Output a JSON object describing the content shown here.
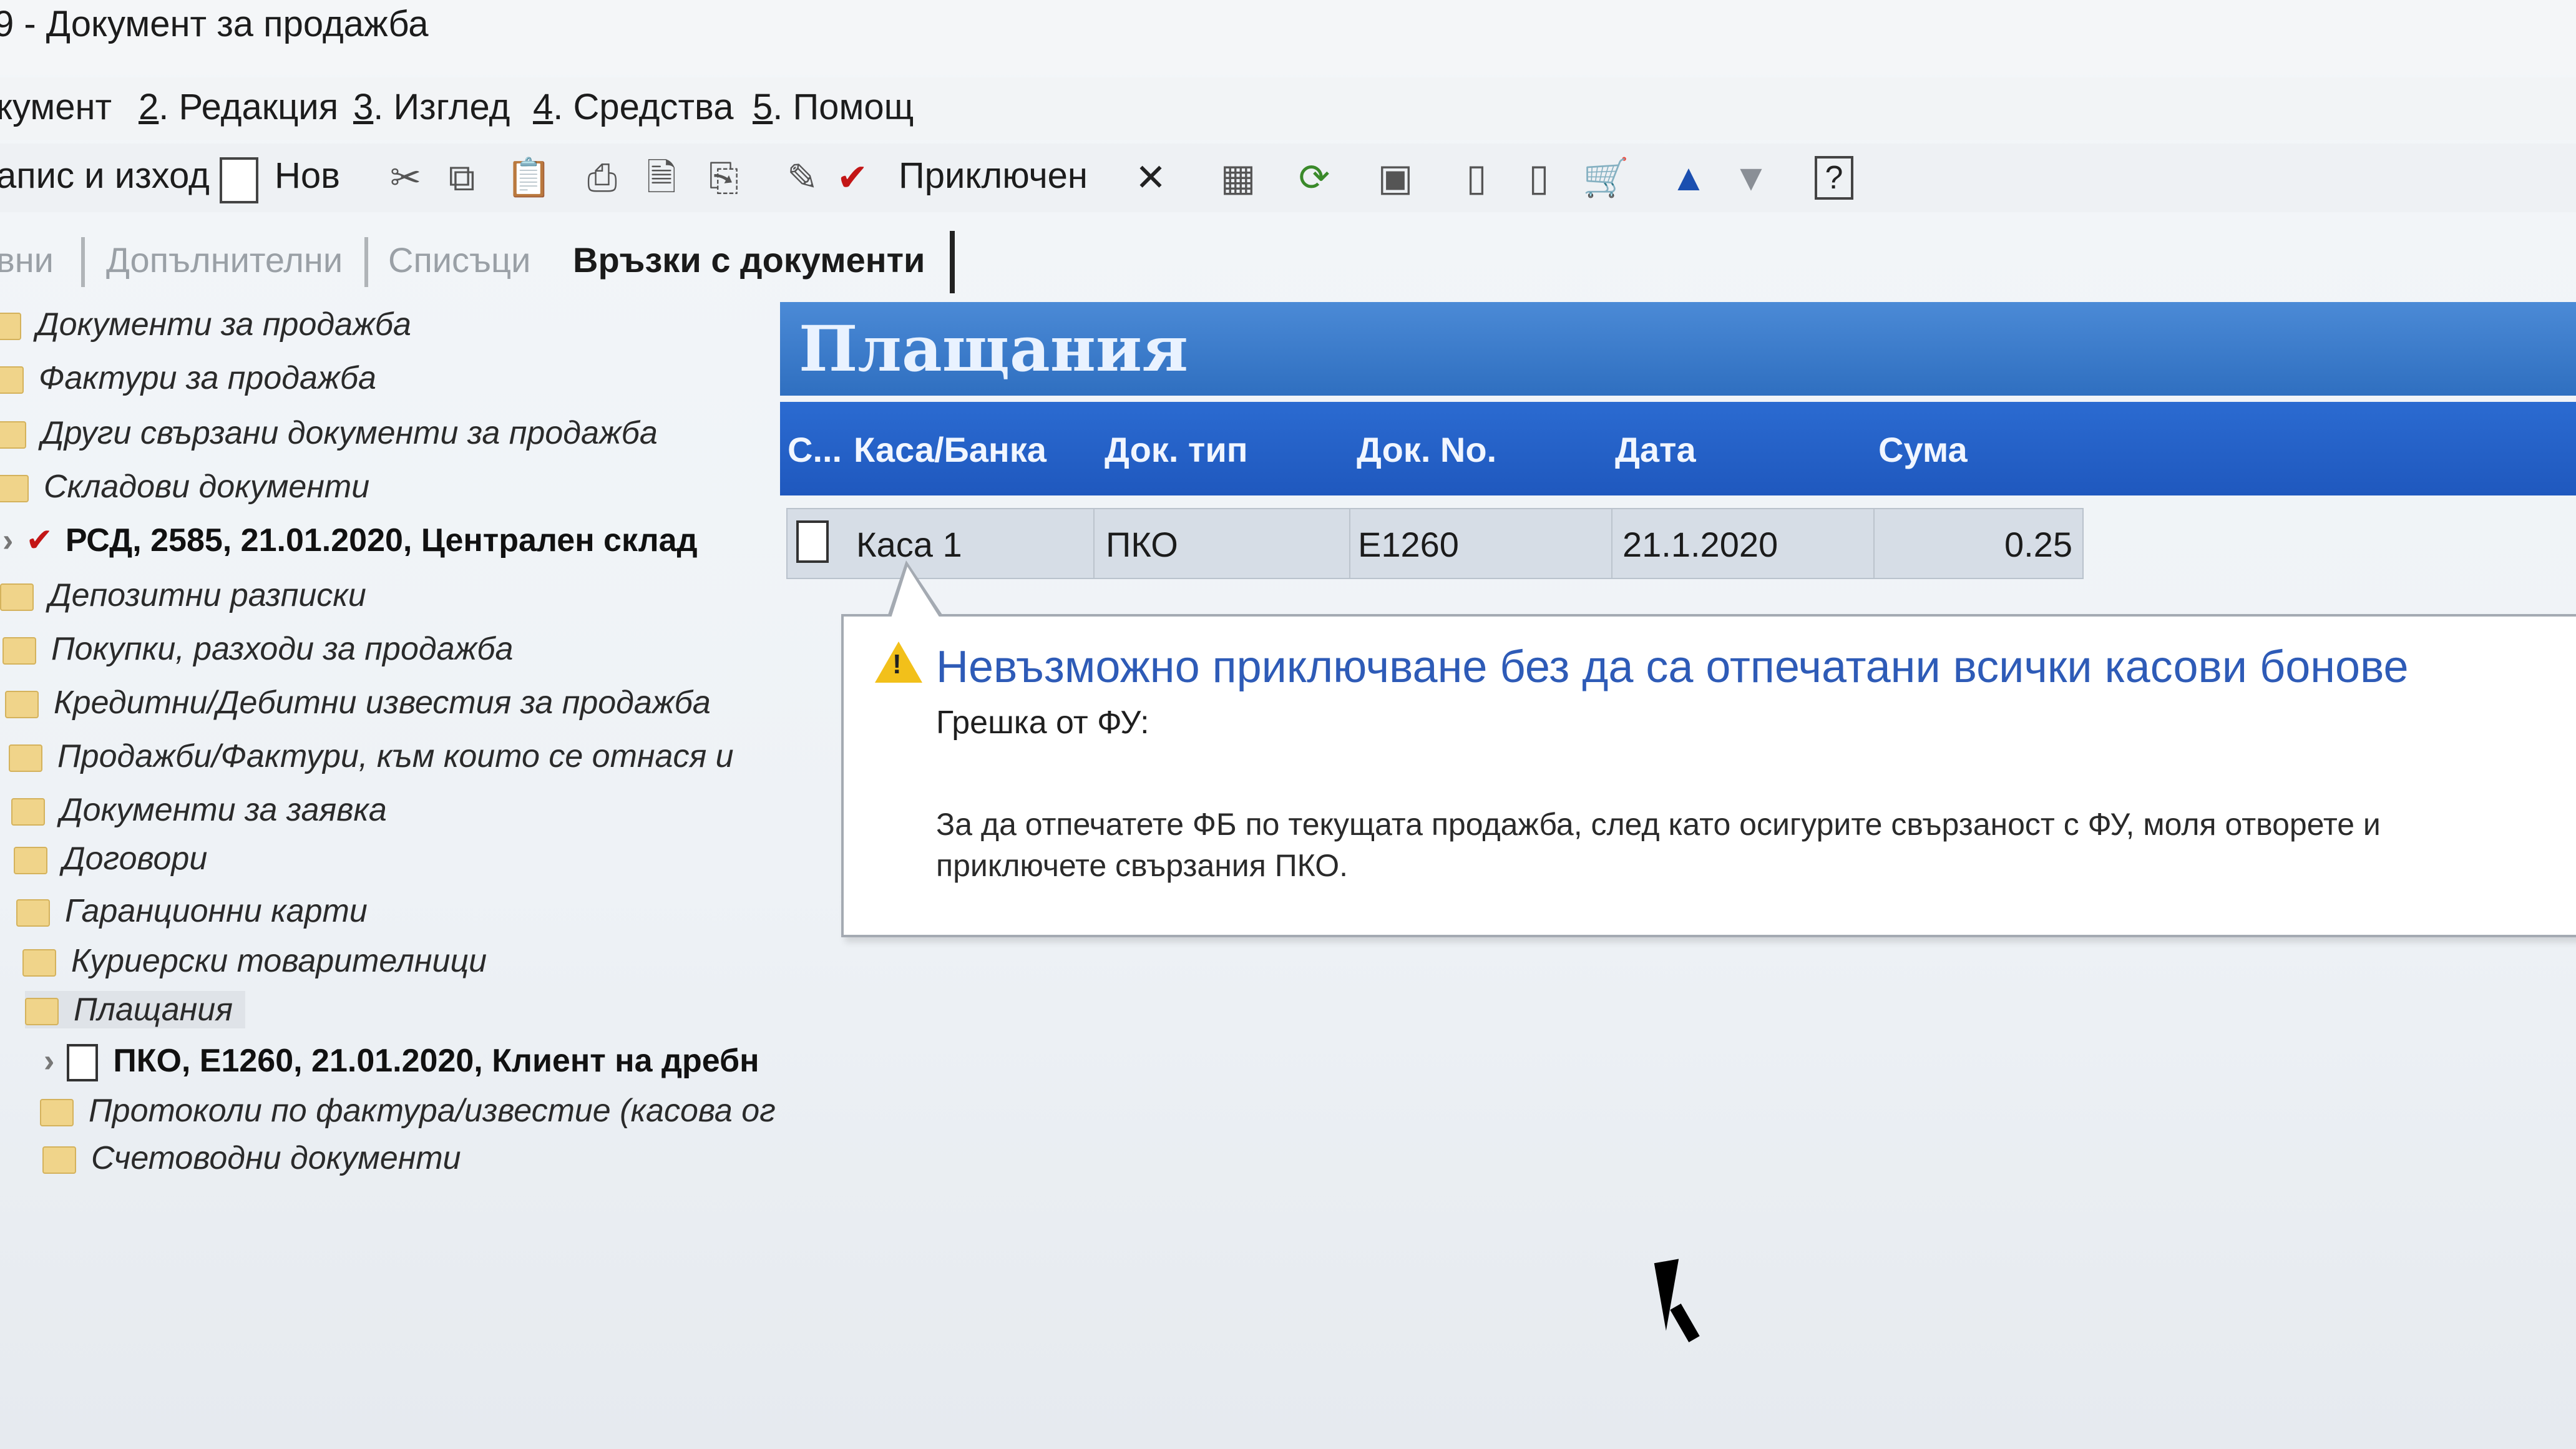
{
  "window": {
    "title": "9 - Документ за продажба"
  },
  "menu": {
    "items": [
      {
        "label": "кумент"
      },
      {
        "num": "2",
        "label": ". Редакция"
      },
      {
        "num": "3",
        "label": ". Изглед"
      },
      {
        "num": "4",
        "label": ". Средства"
      },
      {
        "num": "5",
        "label": ". Помощ"
      }
    ]
  },
  "toolbar": {
    "save_exit_label": "апис и изход",
    "new_label": "Нов",
    "complete_label": "Приключен"
  },
  "tabs": {
    "items": [
      {
        "label": "вни",
        "active": false
      },
      {
        "label": "Допълнителни",
        "active": false
      },
      {
        "label": "Списъци",
        "active": false
      },
      {
        "label": "Връзки с документи",
        "active": true
      }
    ]
  },
  "tree": {
    "items": [
      {
        "label": "Документи за продажба",
        "kind": "folder"
      },
      {
        "label": "Фактури за продажба",
        "kind": "folder"
      },
      {
        "label": "Други свързани документи за продажба",
        "kind": "folder"
      },
      {
        "label": "Складови документи",
        "kind": "folder"
      },
      {
        "label": "РСД, 2585, 21.01.2020, Централен склад",
        "kind": "checked"
      },
      {
        "label": "Депозитни разписки",
        "kind": "folder"
      },
      {
        "label": "Покупки, разходи за продажба",
        "kind": "folder"
      },
      {
        "label": "Кредитни/Дебитни известия за продажба",
        "kind": "folder"
      },
      {
        "label": "Продажби/Фактури, към които се отнася и",
        "kind": "folder"
      },
      {
        "label": "Документи за заявка",
        "kind": "folder"
      },
      {
        "label": "Договори",
        "kind": "folder"
      },
      {
        "label": "Гаранционни карти",
        "kind": "folder"
      },
      {
        "label": "Куриерски товарителници",
        "kind": "folder"
      },
      {
        "label": "Плащания",
        "kind": "folder"
      },
      {
        "label": "ПКО, Е1260, 21.01.2020, Клиент на дребн",
        "kind": "document"
      },
      {
        "label": "Протоколи по фактура/известие (касова ог",
        "kind": "folder"
      },
      {
        "label": "Счетоводни документи",
        "kind": "folder"
      }
    ]
  },
  "payments": {
    "title": "Плащания",
    "columns": [
      "С...",
      "Каса/Банка",
      "Док. тип",
      "Док. No.",
      "Дата",
      "Сума"
    ],
    "rows": [
      {
        "cash_bank": "Каса 1",
        "doc_type": "ПКО",
        "doc_no": "Е1260",
        "date": "21.1.2020",
        "amount": "0.25"
      }
    ]
  },
  "tooltip": {
    "title": "Невъзможно приключване без да са отпечатани всички касови бонове",
    "subtitle": "Грешка от ФУ:",
    "body": "За да отпечатете ФБ по текущата продажба, след като осигурите свързаност с ФУ, моля отворете и приключете свързания ПКО."
  },
  "colors": {
    "accent_blue": "#2f6fc0",
    "header_blue": "#1f58be",
    "warning_yellow": "#f2c01a",
    "check_red": "#c31616",
    "tooltip_title": "#2e5bb7"
  }
}
